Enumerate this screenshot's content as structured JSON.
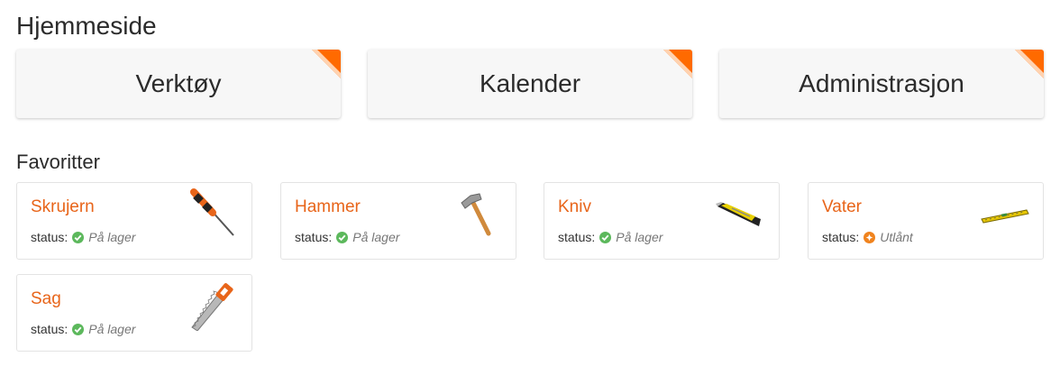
{
  "page_title": "Hjemmeside",
  "accent_color": "#ff6a00",
  "nav_cards": [
    {
      "label": "Verktøy"
    },
    {
      "label": "Kalender"
    },
    {
      "label": "Administrasjon"
    }
  ],
  "favorites": {
    "title": "Favoritter",
    "status_prefix": "status:",
    "items": [
      {
        "name": "Skrujern",
        "status": "På lager",
        "status_type": "available",
        "icon": "screwdriver-icon"
      },
      {
        "name": "Hammer",
        "status": "På lager",
        "status_type": "available",
        "icon": "hammer-icon"
      },
      {
        "name": "Kniv",
        "status": "På lager",
        "status_type": "available",
        "icon": "utility-knife-icon"
      },
      {
        "name": "Vater",
        "status": "Utlånt",
        "status_type": "loaned",
        "icon": "spirit-level-icon"
      },
      {
        "name": "Sag",
        "status": "På lager",
        "status_type": "available",
        "icon": "saw-icon"
      }
    ]
  },
  "status_colors": {
    "available": "#5cb85c",
    "loaned": "#f0831e"
  }
}
